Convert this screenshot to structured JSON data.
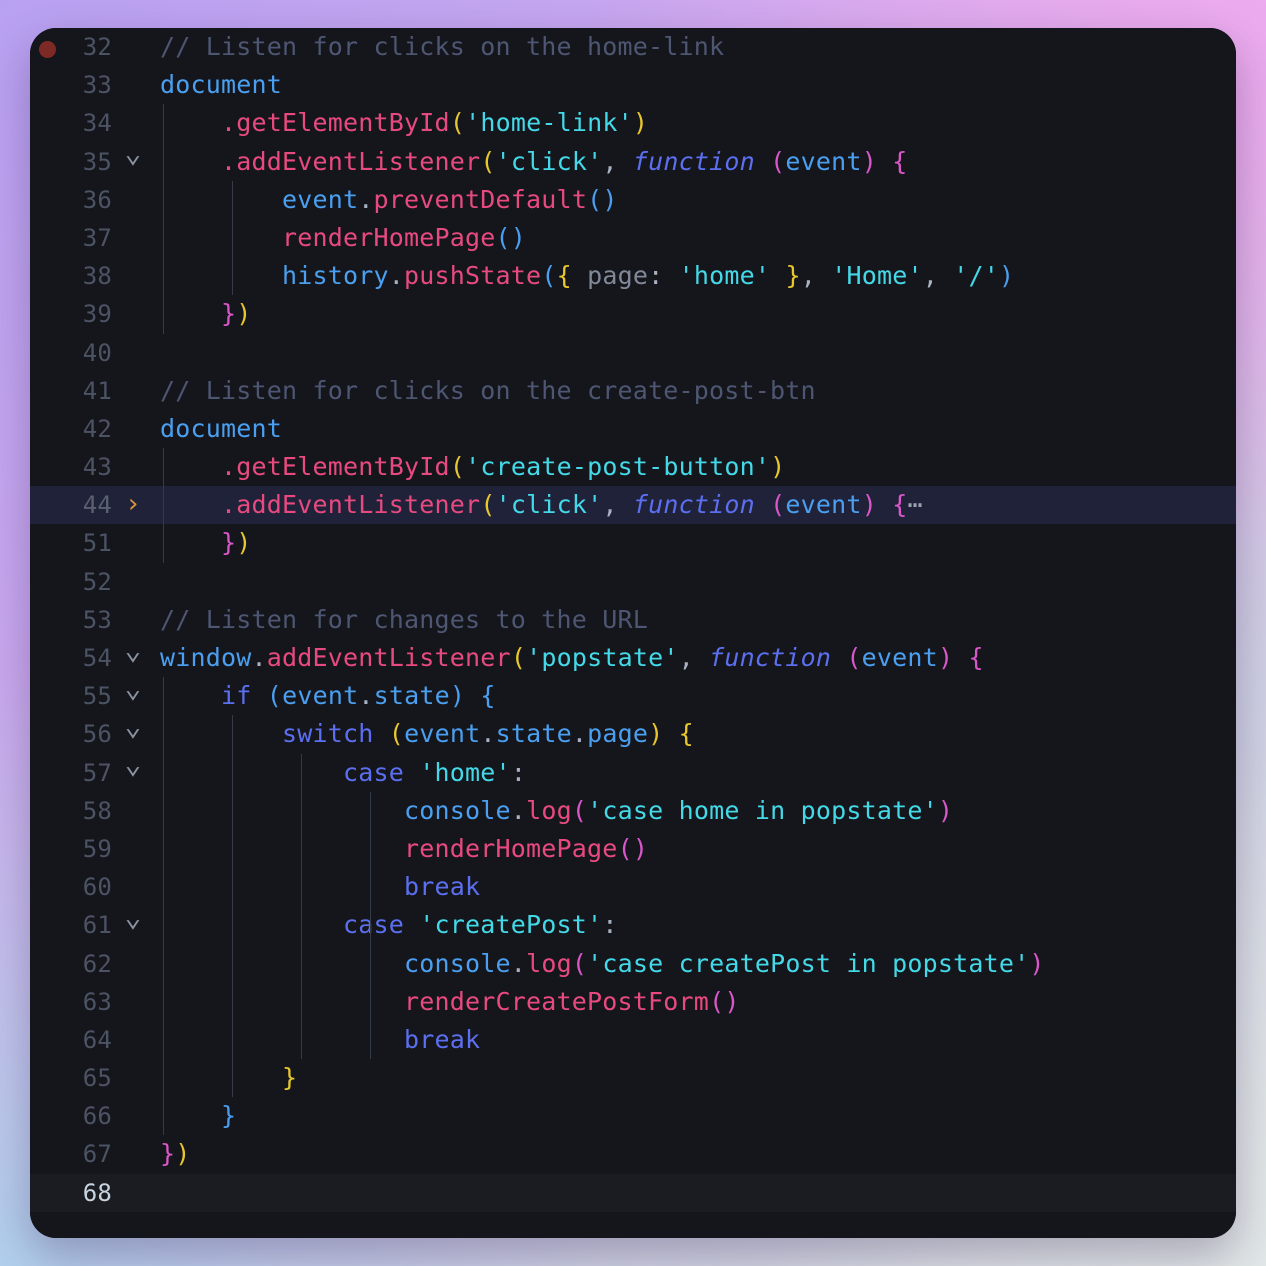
{
  "window": {
    "title": "Code Editor",
    "theme": "dark",
    "background_gradient": [
      "#b9a1f2",
      "#dcb3e8",
      "#cfd2e4",
      "#dfe5e4"
    ],
    "editor_background": "#15161b"
  },
  "colors": {
    "comment": "#4d5672",
    "keyword": "#5b6ff0",
    "identifier": "#4a9ff0",
    "function": "#e84a7f",
    "string": "#44d9e8",
    "property": "#808899",
    "bracket_gold": "#e8c72e",
    "bracket_pink": "#d957c9",
    "bracket_blue": "#4a9ff0",
    "line_number": "#4c5364",
    "focus_line_bg": "#20223a",
    "breakpoint": "#7d2a26",
    "fold_closed_arrow": "#d9943f"
  },
  "gutter": {
    "breakpoint_line": "32",
    "cursor_line": "68",
    "focus_line": "44"
  },
  "code": {
    "language": "javascript",
    "first_line": 32,
    "last_line": 68,
    "folded_range": "45-50",
    "lines": [
      {
        "num": "32",
        "fold": "none",
        "text": "// Listen for clicks on the home-link"
      },
      {
        "num": "33",
        "fold": "none",
        "text": "document"
      },
      {
        "num": "34",
        "fold": "none",
        "text": "    .getElementById('home-link')"
      },
      {
        "num": "35",
        "fold": "open",
        "text": "    .addEventListener('click', function (event) {"
      },
      {
        "num": "36",
        "fold": "none",
        "text": "        event.preventDefault()"
      },
      {
        "num": "37",
        "fold": "none",
        "text": "        renderHomePage()"
      },
      {
        "num": "38",
        "fold": "none",
        "text": "        history.pushState({ page: 'home' }, 'Home', '/')"
      },
      {
        "num": "39",
        "fold": "none",
        "text": "    })"
      },
      {
        "num": "40",
        "fold": "none",
        "text": ""
      },
      {
        "num": "41",
        "fold": "none",
        "text": "// Listen for clicks on the create-post-btn"
      },
      {
        "num": "42",
        "fold": "none",
        "text": "document"
      },
      {
        "num": "43",
        "fold": "none",
        "text": "    .getElementById('create-post-button')"
      },
      {
        "num": "44",
        "fold": "closed",
        "text": "    .addEventListener('click', function (event) {⋯"
      },
      {
        "num": "51",
        "fold": "none",
        "text": "    })"
      },
      {
        "num": "52",
        "fold": "none",
        "text": ""
      },
      {
        "num": "53",
        "fold": "none",
        "text": "// Listen for changes to the URL"
      },
      {
        "num": "54",
        "fold": "open",
        "text": "window.addEventListener('popstate', function (event) {"
      },
      {
        "num": "55",
        "fold": "open",
        "text": "    if (event.state) {"
      },
      {
        "num": "56",
        "fold": "open",
        "text": "        switch (event.state.page) {"
      },
      {
        "num": "57",
        "fold": "open",
        "text": "            case 'home':"
      },
      {
        "num": "58",
        "fold": "none",
        "text": "                console.log('case home in popstate')"
      },
      {
        "num": "59",
        "fold": "none",
        "text": "                renderHomePage()"
      },
      {
        "num": "60",
        "fold": "none",
        "text": "                break"
      },
      {
        "num": "61",
        "fold": "open",
        "text": "            case 'createPost':"
      },
      {
        "num": "62",
        "fold": "none",
        "text": "                console.log('case createPost in popstate')"
      },
      {
        "num": "63",
        "fold": "none",
        "text": "                renderCreatePostForm()"
      },
      {
        "num": "64",
        "fold": "none",
        "text": "                break"
      },
      {
        "num": "65",
        "fold": "none",
        "text": "        }"
      },
      {
        "num": "66",
        "fold": "none",
        "text": "    }"
      },
      {
        "num": "67",
        "fold": "none",
        "text": "})"
      },
      {
        "num": "68",
        "fold": "none",
        "text": ""
      }
    ]
  }
}
